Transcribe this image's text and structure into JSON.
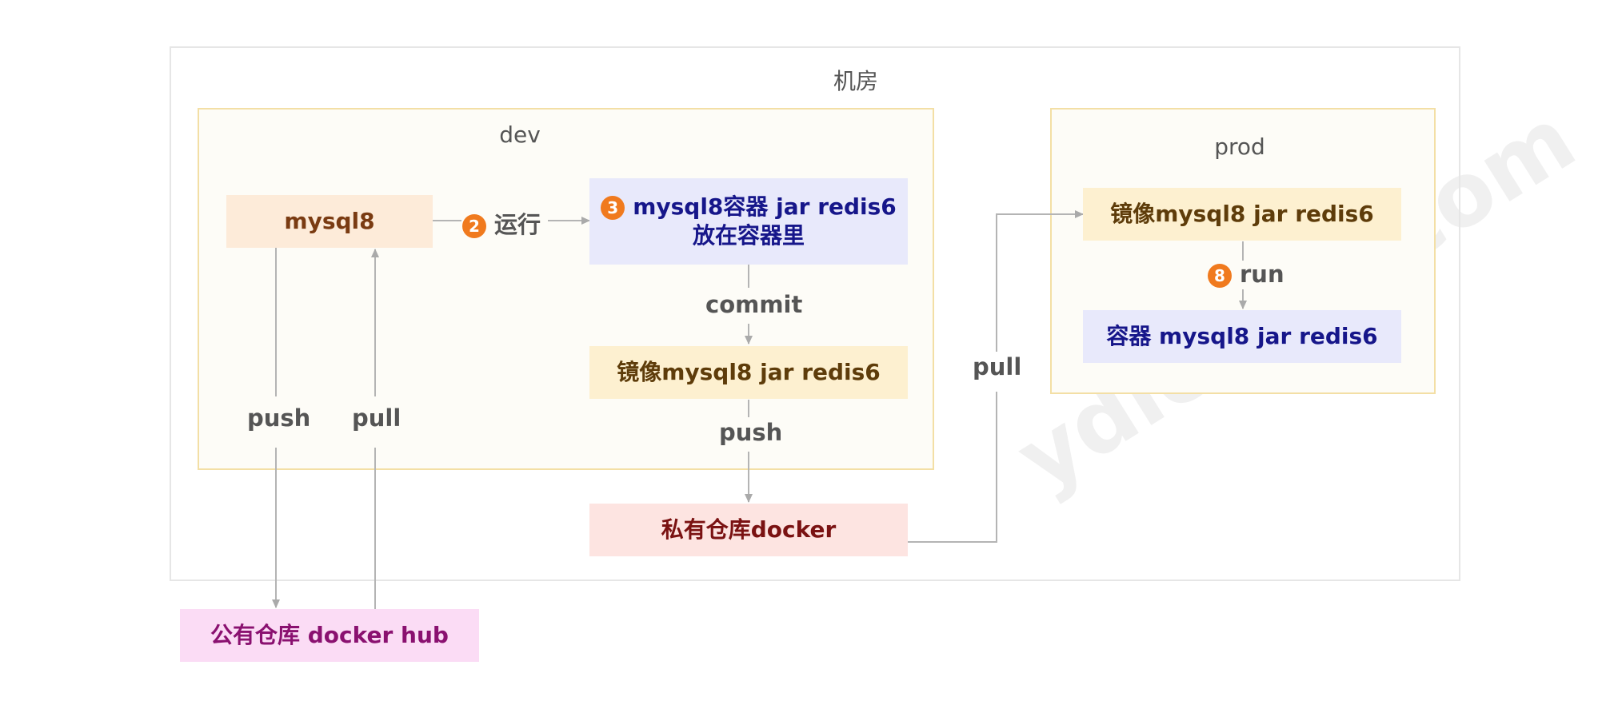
{
  "zones": {
    "datacenter": "机房",
    "dev": "dev",
    "prod": "prod"
  },
  "nodes": {
    "mysql8": "mysql8",
    "container_line1": "mysql8容器 jar redis6",
    "container_line2": "放在容器里",
    "dev_image": "镜像mysql8 jar redis6",
    "private_repo": "私有仓库docker",
    "public_repo": "公有仓库 docker hub",
    "prod_image": "镜像mysql8 jar redis6",
    "prod_container": "容器 mysql8 jar redis6"
  },
  "edges": {
    "run_cn": "运行",
    "run_cn_step": "2",
    "container_step": "3",
    "commit": "commit",
    "push_private": "push",
    "push_public": "push",
    "pull_public": "pull",
    "pull_private": "pull",
    "run": "run",
    "run_step": "8"
  },
  "watermark": "ydlclass.com",
  "colors": {
    "zone_border": "#f3dfa5",
    "zone_fill": "#fdfcf7",
    "datacenter_border": "#e6e6e6",
    "mysql8_fill": "#fdebd9",
    "container_fill": "#e8e9fb",
    "image_fill": "#fdf0d0",
    "private_repo_fill": "#fde4e1",
    "public_repo_fill": "#fbdcf5",
    "badge": "#f07a1e"
  }
}
